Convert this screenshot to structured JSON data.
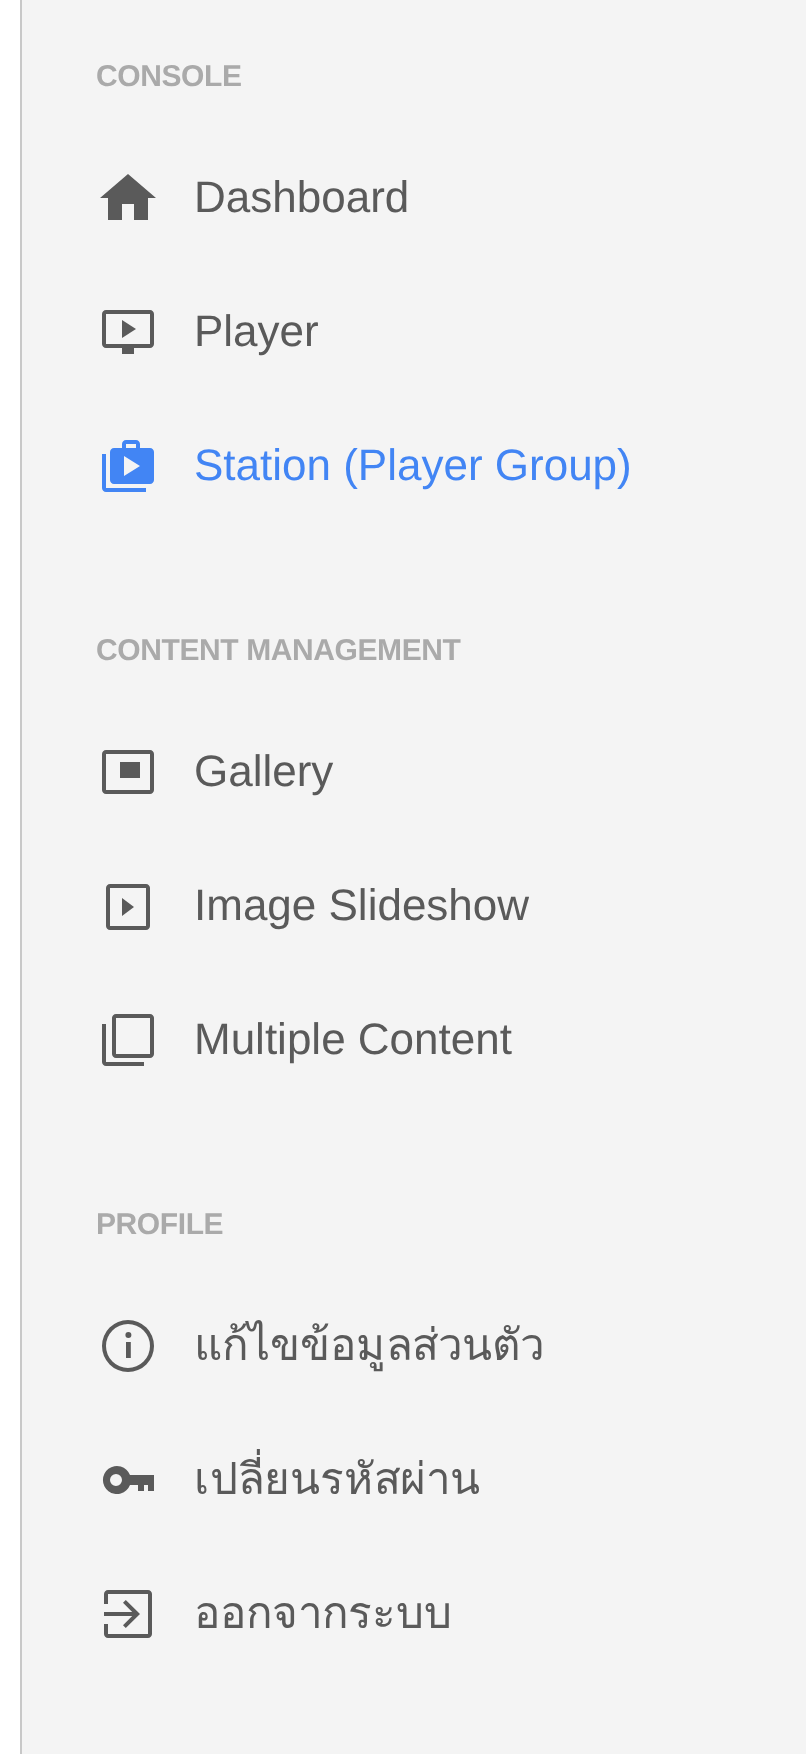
{
  "sections": [
    {
      "heading": "CONSOLE",
      "items": [
        {
          "label": "Dashboard",
          "selected": false
        },
        {
          "label": "Player",
          "selected": false
        },
        {
          "label": "Station (Player Group)",
          "selected": true
        }
      ]
    },
    {
      "heading": "CONTENT MANAGEMENT",
      "items": [
        {
          "label": "Gallery",
          "selected": false
        },
        {
          "label": "Image Slideshow",
          "selected": false
        },
        {
          "label": "Multiple Content",
          "selected": false
        }
      ]
    },
    {
      "heading": "PROFILE",
      "items": [
        {
          "label": "แก้ไขข้อมูลส่วนตัว",
          "selected": false
        },
        {
          "label": "เปลี่ยนรหัสผ่าน",
          "selected": false
        },
        {
          "label": "ออกจากระบบ",
          "selected": false
        }
      ]
    }
  ]
}
